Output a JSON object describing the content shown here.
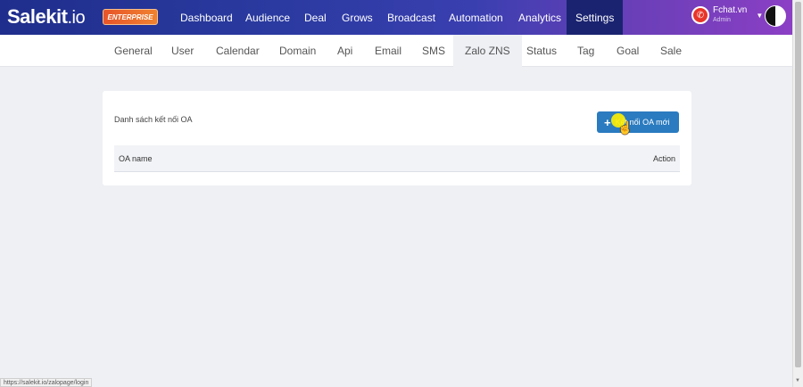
{
  "brand": {
    "logo_main": "Salekit",
    "logo_io": ".io",
    "badge": "ENTERPRISE"
  },
  "nav": {
    "items": [
      "Dashboard",
      "Audience",
      "Deal",
      "Grows",
      "Broadcast",
      "Automation",
      "Analytics",
      "Settings"
    ],
    "active": "Settings"
  },
  "user": {
    "name": "Fchat.vn",
    "role": "Admin"
  },
  "subnav": {
    "items": [
      "General",
      "User",
      "Calendar",
      "Domain",
      "Api",
      "Email",
      "SMS",
      "Zalo ZNS",
      "Status",
      "Tag",
      "Goal",
      "Sale"
    ],
    "active": "Zalo ZNS"
  },
  "card": {
    "title": "Danh sách kết nối OA",
    "add_button": "Kết nối OA mới",
    "columns": [
      "OA name",
      "Action"
    ]
  },
  "status_url": "https://salekit.io/zalopage/login"
}
